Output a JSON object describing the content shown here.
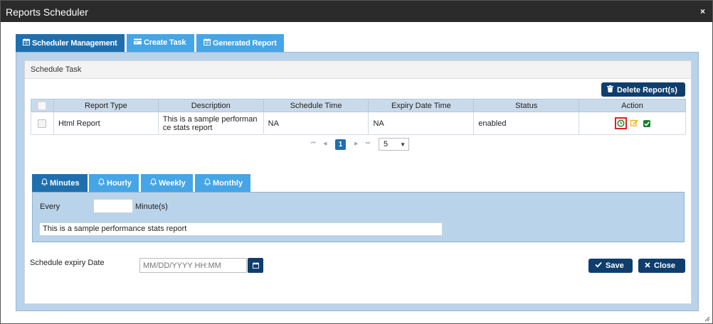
{
  "window": {
    "title": "Reports Scheduler",
    "close_symbol": "×"
  },
  "main_tabs": [
    {
      "label": "Scheduler Management",
      "icon": "calendar-icon",
      "active": true
    },
    {
      "label": "Create Task",
      "icon": "card-icon",
      "active": false
    },
    {
      "label": "Generated Report",
      "icon": "calendar-icon",
      "active": false
    }
  ],
  "section": {
    "title": "Schedule Task"
  },
  "toolbar": {
    "delete_label": "Delete Report(s)",
    "delete_icon": "trash-icon"
  },
  "grid": {
    "columns": [
      "",
      "Report Type",
      "Description",
      "Schedule Time",
      "Expiry Date Time",
      "Status",
      "Action"
    ],
    "rows": [
      {
        "report_type": "Html Report",
        "description_line1": "This is a sample performan",
        "description_line2": "ce stats report",
        "schedule_time": "NA",
        "expiry_date_time": "NA",
        "status": "enabled",
        "actions": [
          "clock-icon",
          "edit-icon",
          "check-icon"
        ]
      }
    ]
  },
  "pager": {
    "current_page": "1",
    "page_size": "5",
    "first": "⏮",
    "prev": "◀",
    "next": "▶",
    "last": "⏭",
    "caret": "▼"
  },
  "sub_tabs": [
    {
      "label": "Minutes",
      "icon": "bell-icon",
      "active": true
    },
    {
      "label": "Hourly",
      "icon": "bell-icon",
      "active": false
    },
    {
      "label": "Weekly",
      "icon": "bell-icon",
      "active": false
    },
    {
      "label": "Monthly",
      "icon": "bell-icon",
      "active": false
    }
  ],
  "minutes_form": {
    "every_label": "Every",
    "minutes_value": "",
    "minutes_unit": "Minute(s)",
    "description_value": "This is a sample performance stats report"
  },
  "expiry": {
    "label": "Schedule expiry Date",
    "placeholder": "MM/DD/YYYY HH:MM"
  },
  "buttons": {
    "save_label": "Save",
    "close_label": "Close"
  },
  "colors": {
    "active_tab": "#1f6fae",
    "inactive_tab": "#45a5e6",
    "panel_bg": "#b9d3ea",
    "dark_button": "#0f3e6d",
    "title_bar": "#2b2b2b"
  }
}
